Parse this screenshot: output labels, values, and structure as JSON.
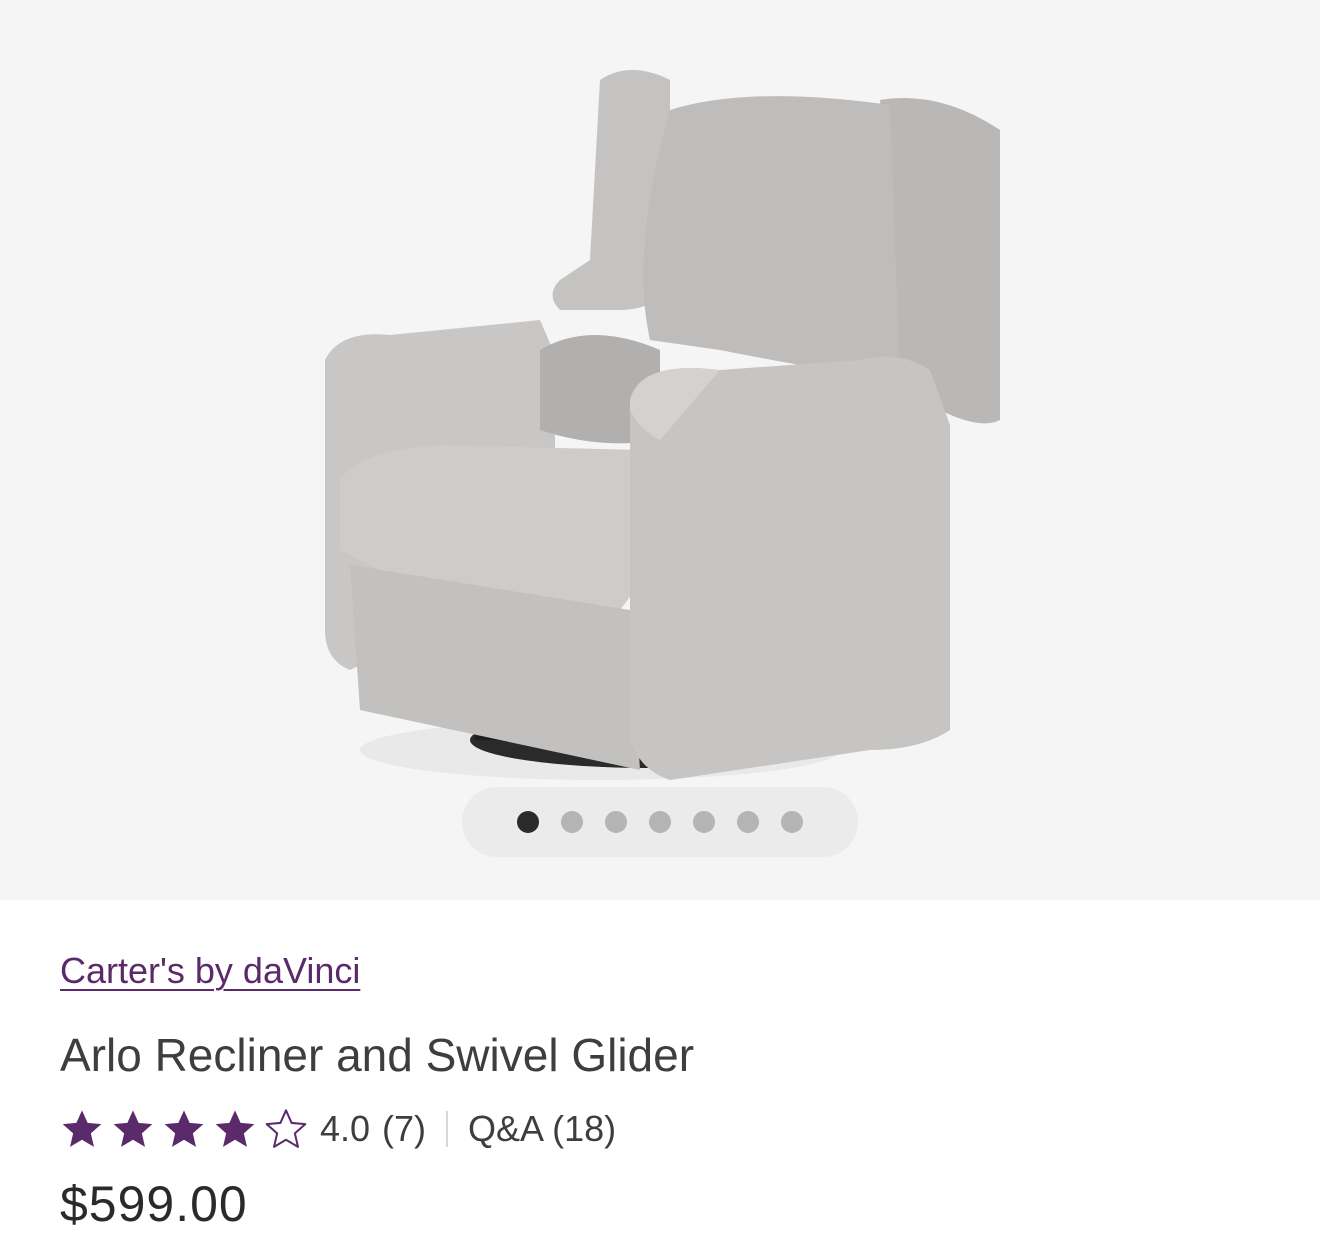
{
  "gallery": {
    "image_alt": "Gray upholstered wingback recliner and swivel glider chair",
    "dot_count": 7,
    "active_index": 0
  },
  "product": {
    "brand": "Carter's by daVinci",
    "title": "Arlo Recliner and Swivel Glider",
    "rating_value": "4.0",
    "rating_stars": 4,
    "rating_max": 5,
    "rating_count": "(7)",
    "qa_label": "Q&A (18)",
    "price": "$599.00"
  },
  "colors": {
    "accent": "#5a2a6a",
    "text": "#3e3e3e",
    "gallery_bg": "#f5f5f5",
    "dot_active": "#2b2b2b",
    "dot_inactive": "#b4b4b4"
  },
  "icons": {
    "star_filled": "star-filled-icon",
    "star_empty": "star-outline-icon"
  }
}
